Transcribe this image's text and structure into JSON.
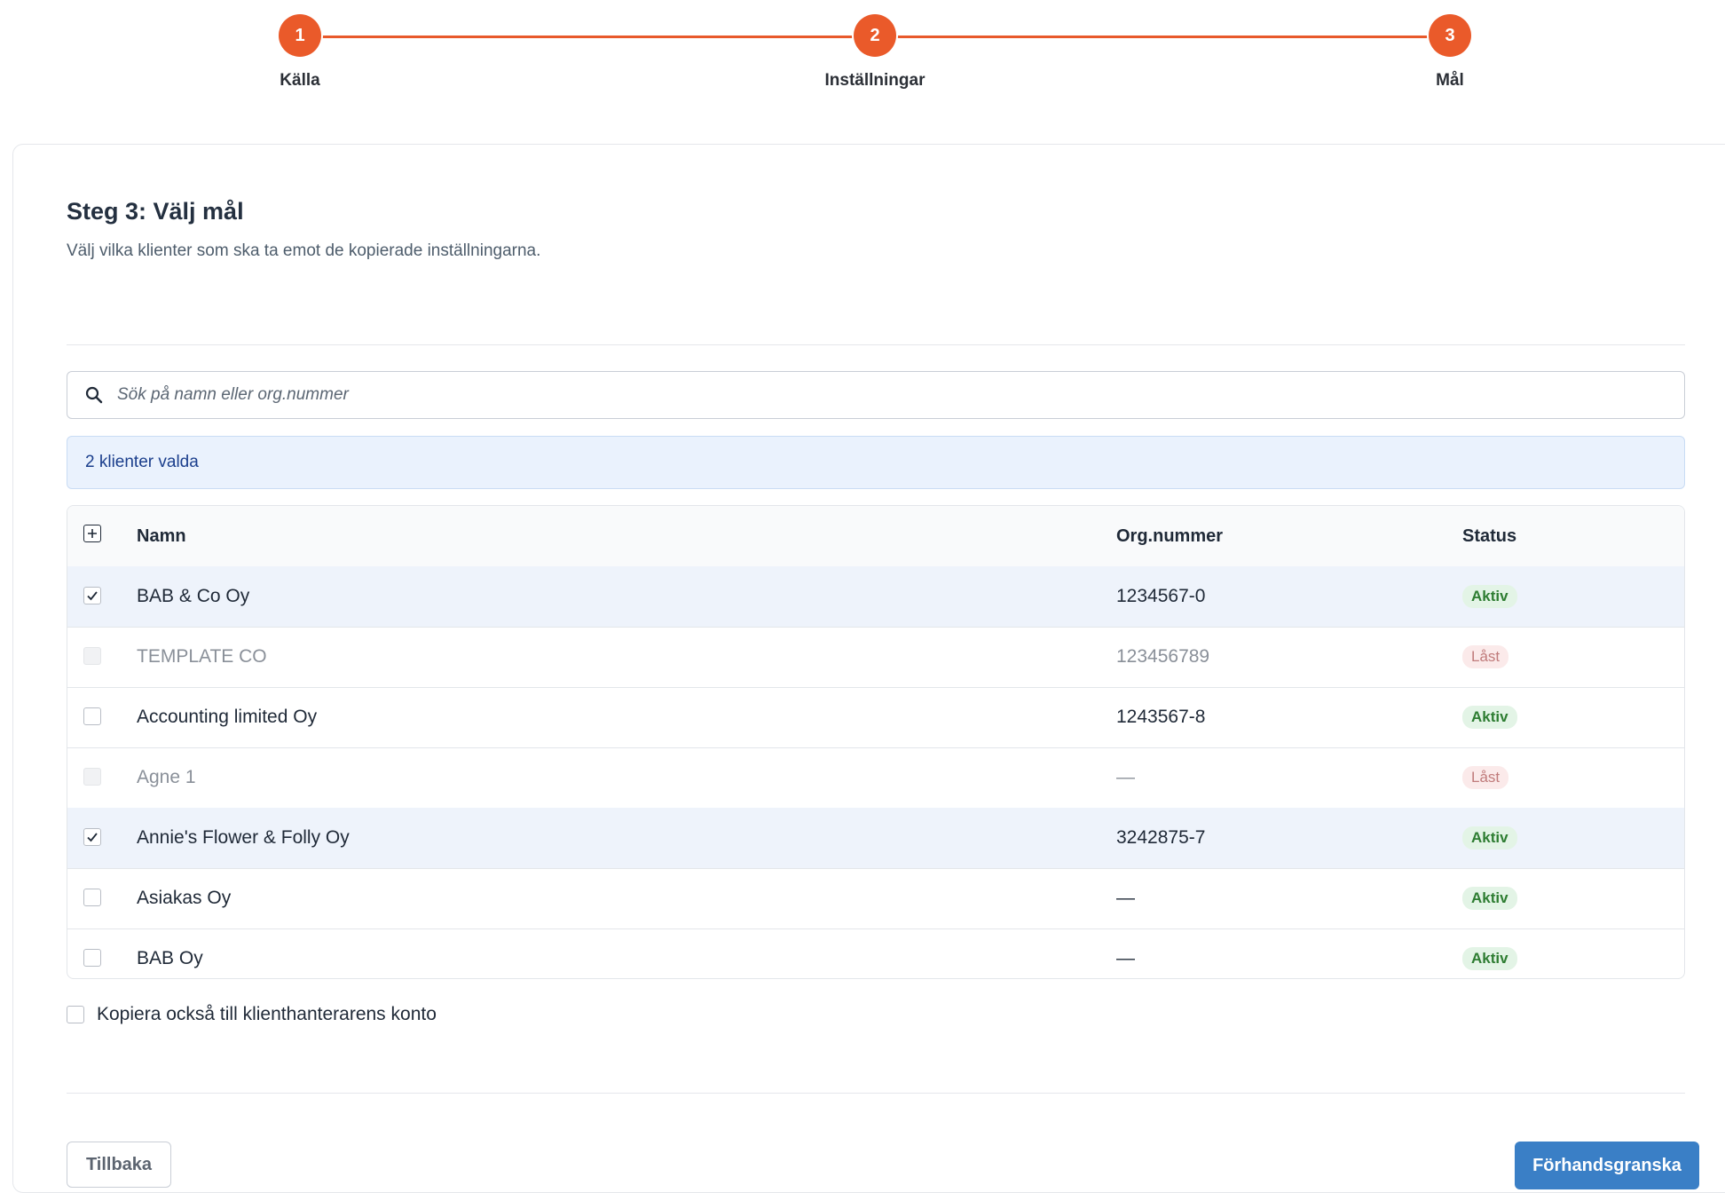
{
  "stepper": {
    "steps": [
      {
        "number": "1",
        "label": "Källa"
      },
      {
        "number": "2",
        "label": "Inställningar"
      },
      {
        "number": "3",
        "label": "Mål"
      }
    ],
    "accent_color": "#ea5a2a"
  },
  "header": {
    "title": "Steg 3: Välj mål",
    "subtitle": "Välj vilka klienter som ska ta emot de kopierade inställningarna."
  },
  "search": {
    "placeholder": "Sök på namn eller org.nummer",
    "value": ""
  },
  "selection": {
    "summary": "2 klienter valda"
  },
  "table": {
    "columns": {
      "name": "Namn",
      "org": "Org.nummer",
      "status": "Status"
    },
    "rows": [
      {
        "name": "BAB & Co Oy",
        "org": "1234567-0",
        "status": "Aktiv",
        "checked": true,
        "locked": false
      },
      {
        "name": "TEMPLATE CO",
        "org": "123456789",
        "status": "Låst",
        "checked": false,
        "locked": true
      },
      {
        "name": "Accounting limited Oy",
        "org": "1243567-8",
        "status": "Aktiv",
        "checked": false,
        "locked": false
      },
      {
        "name": "Agne 1",
        "org": "—",
        "status": "Låst",
        "checked": false,
        "locked": true
      },
      {
        "name": "Annie's Flower & Folly Oy",
        "org": "3242875-7",
        "status": "Aktiv",
        "checked": true,
        "locked": false
      },
      {
        "name": "Asiakas Oy",
        "org": "—",
        "status": "Aktiv",
        "checked": false,
        "locked": false
      },
      {
        "name": "BAB Oy",
        "org": "—",
        "status": "Aktiv",
        "checked": false,
        "locked": false
      }
    ]
  },
  "options": {
    "copy_to_manager_label": "Kopiera också till klienthanterarens konto",
    "copy_to_manager_checked": false
  },
  "footer": {
    "back_label": "Tillbaka",
    "preview_label": "Förhandsgranska",
    "primary_color": "#3a7fc6"
  }
}
